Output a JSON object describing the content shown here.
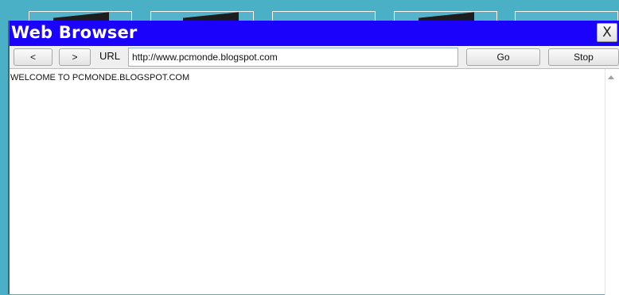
{
  "window": {
    "title": "Web Browser",
    "close_label": "X"
  },
  "toolbar": {
    "back_label": "<",
    "forward_label": ">",
    "url_label": "URL",
    "url_value": "http://www.pcmonde.blogspot.com",
    "go_label": "Go",
    "stop_label": "Stop"
  },
  "content": {
    "text": "WELCOME TO PCMONDE.BLOGSPOT.COM"
  },
  "colors": {
    "titlebar": "#1b02fb",
    "desktop": "#4ab0c6"
  },
  "icons": {
    "scroll_up": "scroll-up-arrow-icon"
  }
}
